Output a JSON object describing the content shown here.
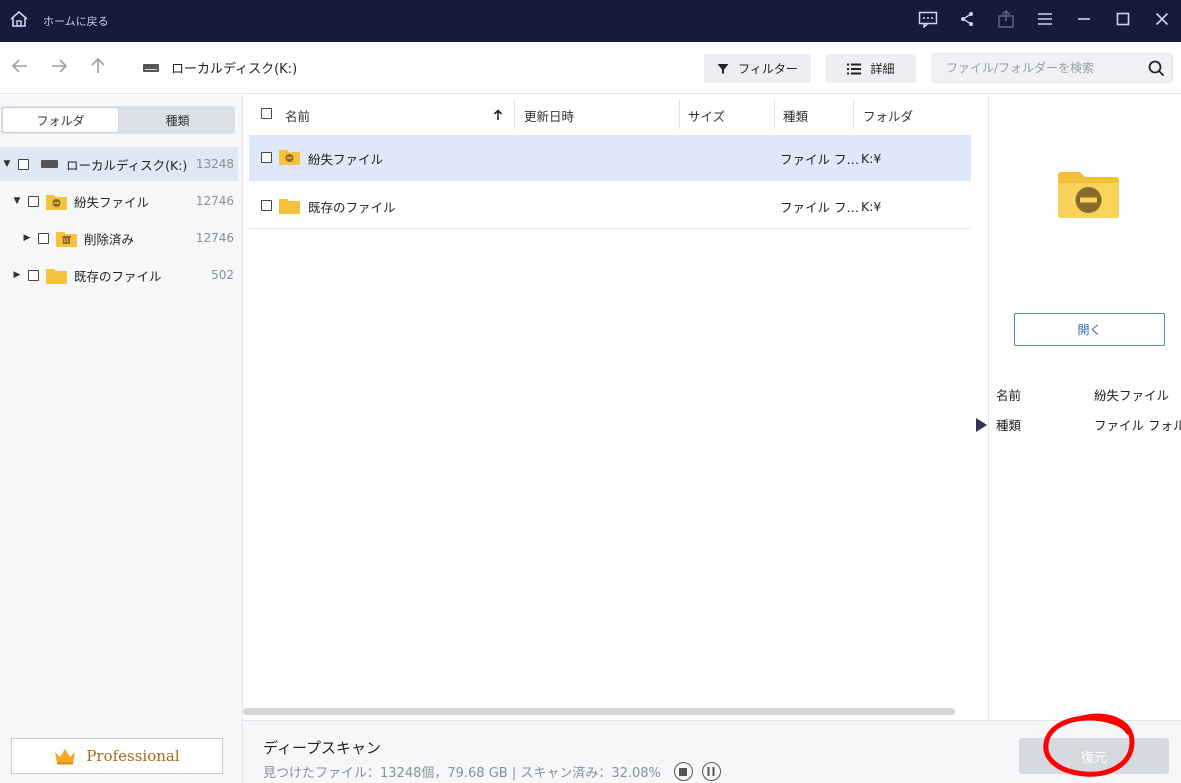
{
  "titlebar": {
    "home_label": "ホームに戻る"
  },
  "toolbar": {
    "path_label": "ローカルディスク(K:)",
    "filter_label": "フィルター",
    "details_label": "詳細",
    "search_placeholder": "ファイル/フォルダーを検索"
  },
  "left": {
    "tabs": [
      "フォルダ",
      "種類"
    ],
    "tree": [
      {
        "label": "ローカルディスク(K:)",
        "count": "13248"
      },
      {
        "label": "紛失ファイル",
        "count": "12746"
      },
      {
        "label": "削除済み",
        "count": "12746"
      },
      {
        "label": "既存のファイル",
        "count": "502"
      }
    ],
    "professional_label": "Professional"
  },
  "list": {
    "columns": [
      "名前",
      "更新日時",
      "サイズ",
      "種類",
      "フォルダ"
    ],
    "rows": [
      {
        "name": "紛失ファイル",
        "date": "",
        "size": "",
        "type": "ファイル フ…",
        "folder": "K:¥"
      },
      {
        "name": "既存のファイル",
        "date": "",
        "size": "",
        "type": "ファイル フ…",
        "folder": "K:¥"
      }
    ]
  },
  "details": {
    "open_label": "開く",
    "name_key": "名前",
    "name_value": "紛失ファイル",
    "type_key": "種類",
    "type_value": "ファイル フォルダー"
  },
  "bottom": {
    "scan_title": "ディープスキャン",
    "scan_stats": "見つけたファイル：13248個，79.68 GB | スキャン済み：32.08%",
    "recover_label": "復元"
  },
  "colors": {
    "titlebar": "#141b3e",
    "folder_yellow": "#f6c23e",
    "selection": "#dee8f8",
    "accent_blue": "#2c6ab0",
    "pro_gold": "#a56a1c",
    "annotation_red": "#ff0000"
  }
}
